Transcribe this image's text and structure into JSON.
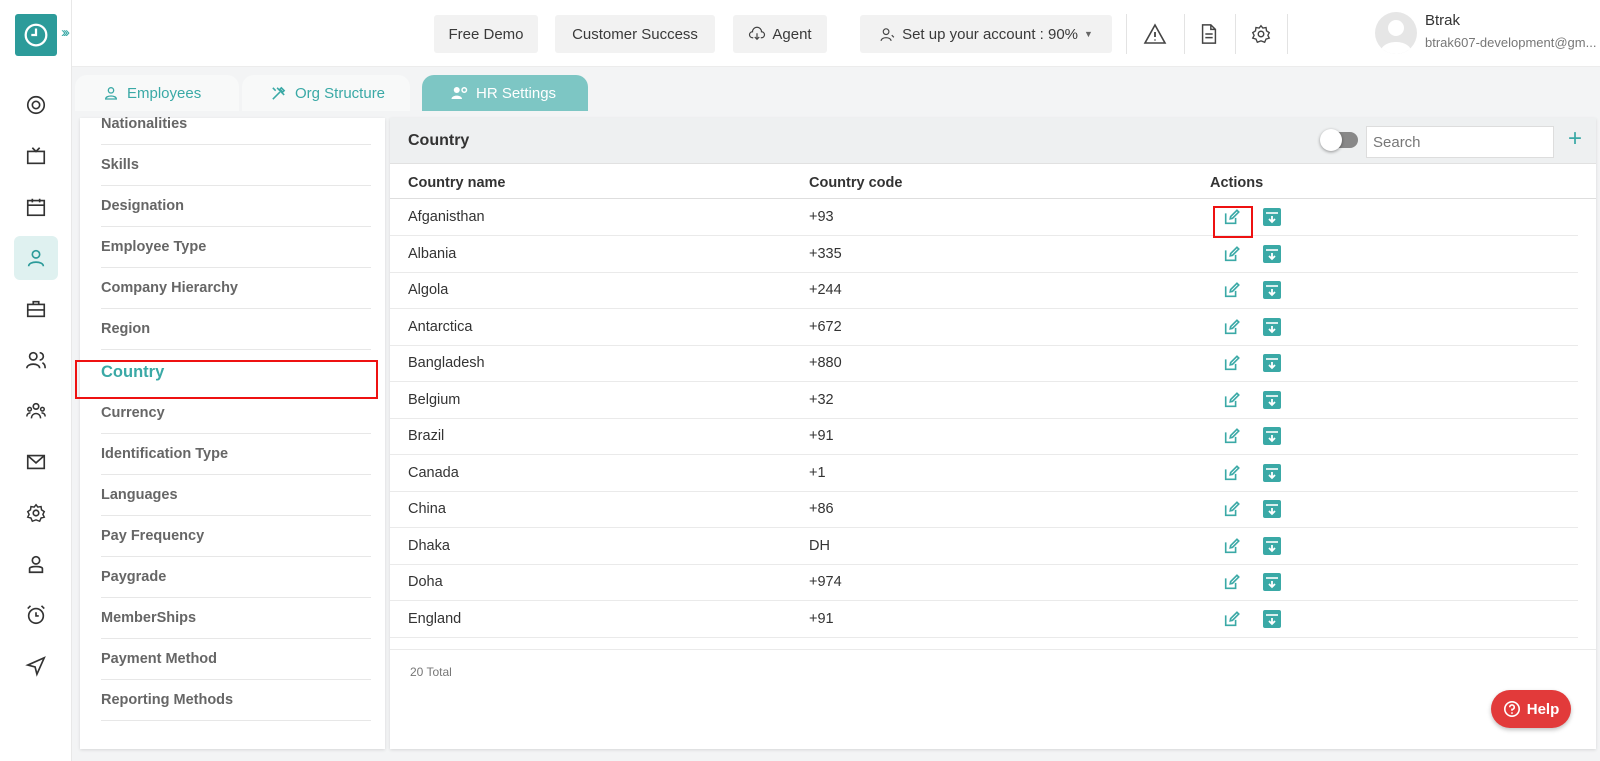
{
  "header": {
    "buttons": [
      "Free Demo",
      "Customer Success",
      "Agent"
    ],
    "setup_label": "Set up your account : 90%",
    "user_name": "Btrak",
    "user_email": "btrak607-development@gm..."
  },
  "tabs": [
    {
      "label": "Employees",
      "icon": "person-icon"
    },
    {
      "label": "Org Structure",
      "icon": "tools-icon"
    },
    {
      "label": "HR Settings",
      "icon": "user-gear-icon"
    }
  ],
  "settings_items": [
    "Nationalities",
    "Skills",
    "Designation",
    "Employee Type",
    "Company Hierarchy",
    "Region",
    "Country",
    "Currency",
    "Identification Type",
    "Languages",
    "Pay Frequency",
    "Paygrade",
    "MemberShips",
    "Payment Method",
    "Reporting Methods"
  ],
  "active_setting": "Country",
  "panel": {
    "title": "Country",
    "search_placeholder": "Search",
    "add_label": "+",
    "columns": [
      "Country name",
      "Country code",
      "Actions"
    ],
    "rows": [
      {
        "name": "Afganisthan",
        "code": "+93"
      },
      {
        "name": "Albania",
        "code": "+335"
      },
      {
        "name": "Algola",
        "code": "+244"
      },
      {
        "name": "Antarctica",
        "code": "+672"
      },
      {
        "name": "Bangladesh",
        "code": "+880"
      },
      {
        "name": "Belgium",
        "code": "+32"
      },
      {
        "name": "Brazil",
        "code": "+91"
      },
      {
        "name": "Canada",
        "code": "+1"
      },
      {
        "name": "China",
        "code": "+86"
      },
      {
        "name": "Dhaka",
        "code": "DH"
      },
      {
        "name": "Doha",
        "code": "+974"
      },
      {
        "name": "England",
        "code": "+91"
      }
    ],
    "total": "20 Total"
  },
  "help_label": "Help",
  "colors": {
    "accent": "#3aa9a6",
    "highlight": "#e11111",
    "help": "#e23a3a"
  }
}
